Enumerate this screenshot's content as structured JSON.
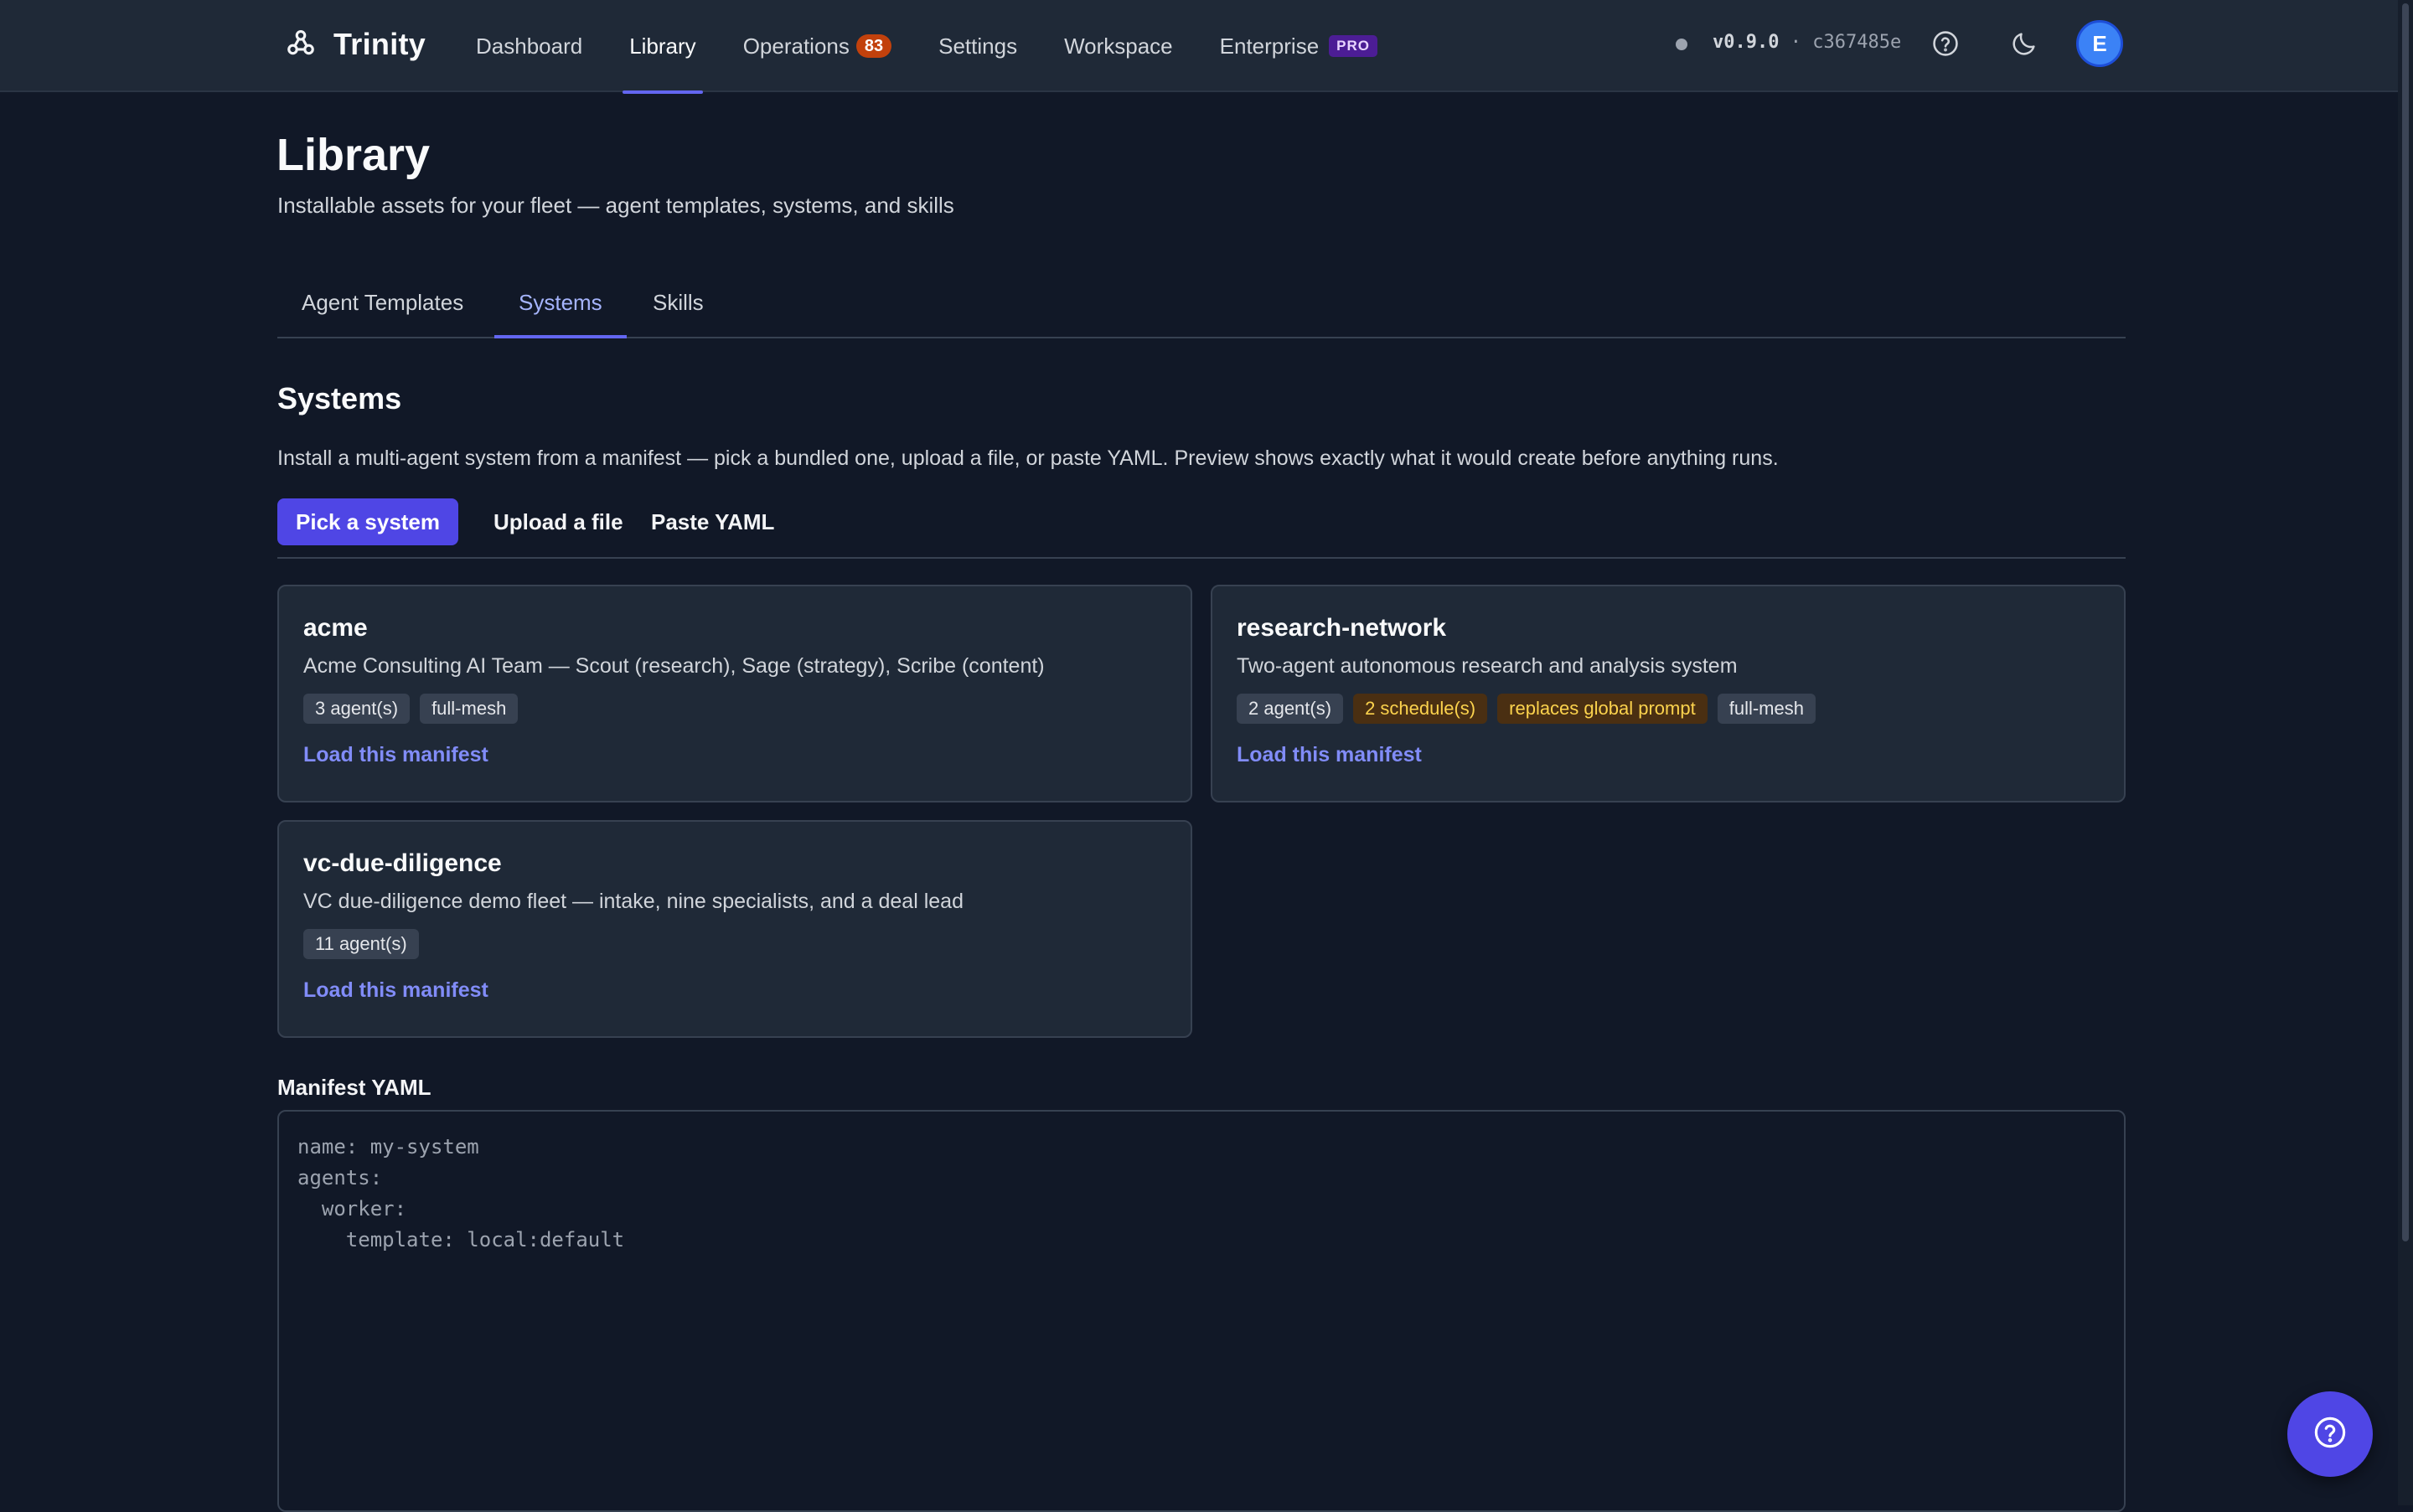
{
  "nav": {
    "brand": "Trinity",
    "brand_icon": "trinity-logo-icon",
    "links": [
      {
        "label": "Dashboard",
        "active": false
      },
      {
        "label": "Library",
        "active": true
      },
      {
        "label": "Operations",
        "badge": "83",
        "active": false
      },
      {
        "label": "Settings",
        "active": false
      },
      {
        "label": "Workspace",
        "active": false
      },
      {
        "label": "Enterprise",
        "tag": "PRO",
        "active": false
      }
    ],
    "version": "v0.9.0",
    "separator": "·",
    "commit": "c367485e",
    "help_icon": "help-circle-icon",
    "theme_icon": "moon-icon",
    "avatar_initial": "E"
  },
  "page": {
    "title": "Library",
    "subtitle": "Installable assets for your fleet — agent templates, systems, and skills"
  },
  "tabs": [
    {
      "label": "Agent Templates",
      "active": false
    },
    {
      "label": "Systems",
      "active": true
    },
    {
      "label": "Skills",
      "active": false
    }
  ],
  "systems": {
    "title": "Systems",
    "description": "Install a multi-agent system from a manifest — pick a bundled one, upload a file, or paste YAML. Preview shows exactly what it would create before anything runs.",
    "subtabs": [
      {
        "label": "Pick a system",
        "active": true
      },
      {
        "label": "Upload a file",
        "active": false
      },
      {
        "label": "Paste YAML",
        "active": false
      }
    ],
    "cards": [
      {
        "name": "acme",
        "description": "Acme Consulting AI Team — Scout (research), Sage (strategy), Scribe (content)",
        "tags": [
          {
            "text": "3 agent(s)",
            "style": "neutral"
          },
          {
            "text": "full-mesh",
            "style": "neutral"
          }
        ],
        "link": "Load this manifest"
      },
      {
        "name": "research-network",
        "description": "Two-agent autonomous research and analysis system",
        "tags": [
          {
            "text": "2 agent(s)",
            "style": "neutral"
          },
          {
            "text": "2 schedule(s)",
            "style": "warn"
          },
          {
            "text": "replaces global prompt",
            "style": "warn"
          },
          {
            "text": "full-mesh",
            "style": "neutral"
          }
        ],
        "link": "Load this manifest"
      },
      {
        "name": "vc-due-diligence",
        "description": "VC due-diligence demo fleet — intake, nine specialists, and a deal lead",
        "tags": [
          {
            "text": "11 agent(s)",
            "style": "neutral"
          }
        ],
        "link": "Load this manifest"
      }
    ],
    "manifest_label": "Manifest YAML",
    "manifest_placeholder": "name: my-system\nagents:\n  worker:\n    template: local:default"
  },
  "floating_help": {
    "icon": "help-circle-icon"
  },
  "colors": {
    "background": "#111827",
    "surface": "#1f2937",
    "accent": "#4f46e5",
    "accent_text": "#818cf8",
    "badge_orange": "#c2410c",
    "pro_purple": "#4c1d95",
    "warn_tag_bg": "#4a2f12",
    "warn_tag_text": "#fcd34d"
  }
}
